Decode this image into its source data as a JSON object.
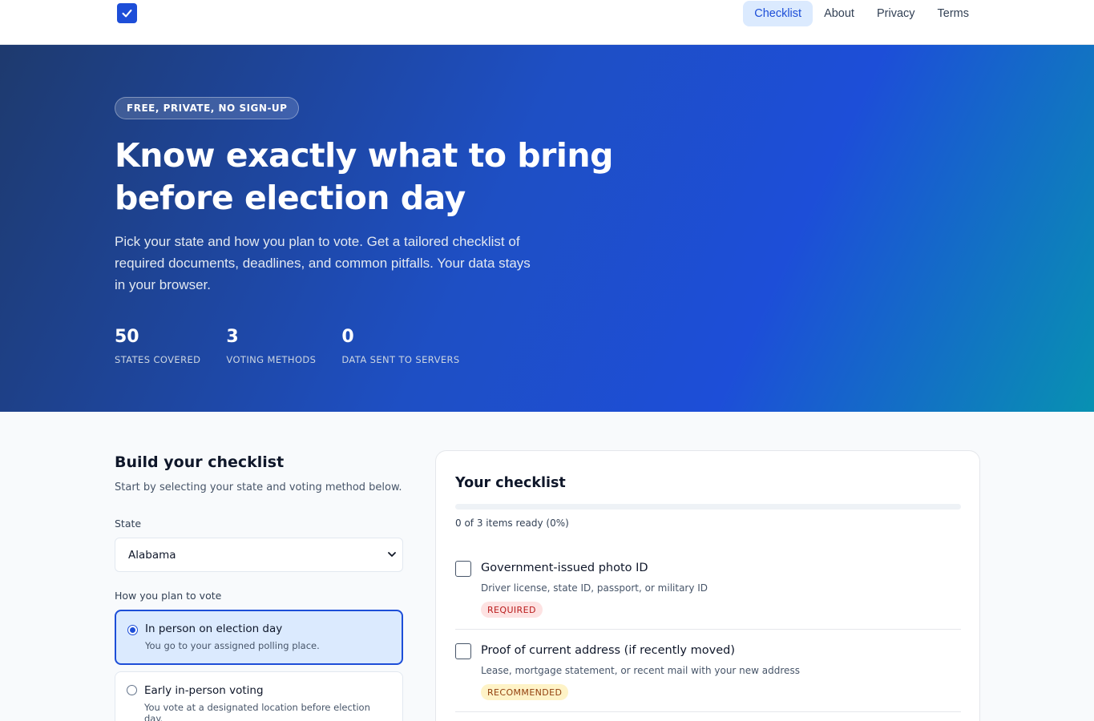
{
  "nav": {
    "logo_icon": "check-icon",
    "links": [
      {
        "label": "Checklist",
        "active": true
      },
      {
        "label": "About",
        "active": false
      },
      {
        "label": "Privacy",
        "active": false
      },
      {
        "label": "Terms",
        "active": false
      }
    ]
  },
  "hero": {
    "pill": "FREE, PRIVATE, NO SIGN-UP",
    "title": "Know exactly what to bring before election day",
    "subtitle": "Pick your state and how you plan to vote. Get a tailored checklist of required documents, deadlines, and common pitfalls. Your data stays in your browser.",
    "stats": [
      {
        "value": "50",
        "label": "STATES COVERED"
      },
      {
        "value": "3",
        "label": "VOTING METHODS"
      },
      {
        "value": "0",
        "label": "DATA SENT TO SERVERS"
      }
    ]
  },
  "builder": {
    "title": "Build your checklist",
    "subtitle": "Start by selecting your state and voting method below.",
    "state_label": "State",
    "state_value": "Alabama",
    "method_label": "How you plan to vote",
    "methods": [
      {
        "title": "In person on election day",
        "desc": "You go to your assigned polling place.",
        "selected": true
      },
      {
        "title": "Early in-person voting",
        "desc": "You vote at a designated location before election day.",
        "selected": false
      }
    ]
  },
  "checklist": {
    "title": "Your checklist",
    "progress_text": "0 of 3 items ready (0%)",
    "progress_fraction": 0,
    "items": [
      {
        "title": "Government-issued photo ID",
        "desc": "Driver license, state ID, passport, or military ID",
        "badge": "REQUIRED"
      },
      {
        "title": "Proof of current address (if recently moved)",
        "desc": "Lease, mortgage statement, or recent mail with your new address",
        "badge": "RECOMMENDED"
      }
    ]
  },
  "colors": {
    "accent": "#1d4ed8",
    "required_bg": "#fde2e2",
    "recommended_bg": "#fef3c7"
  }
}
